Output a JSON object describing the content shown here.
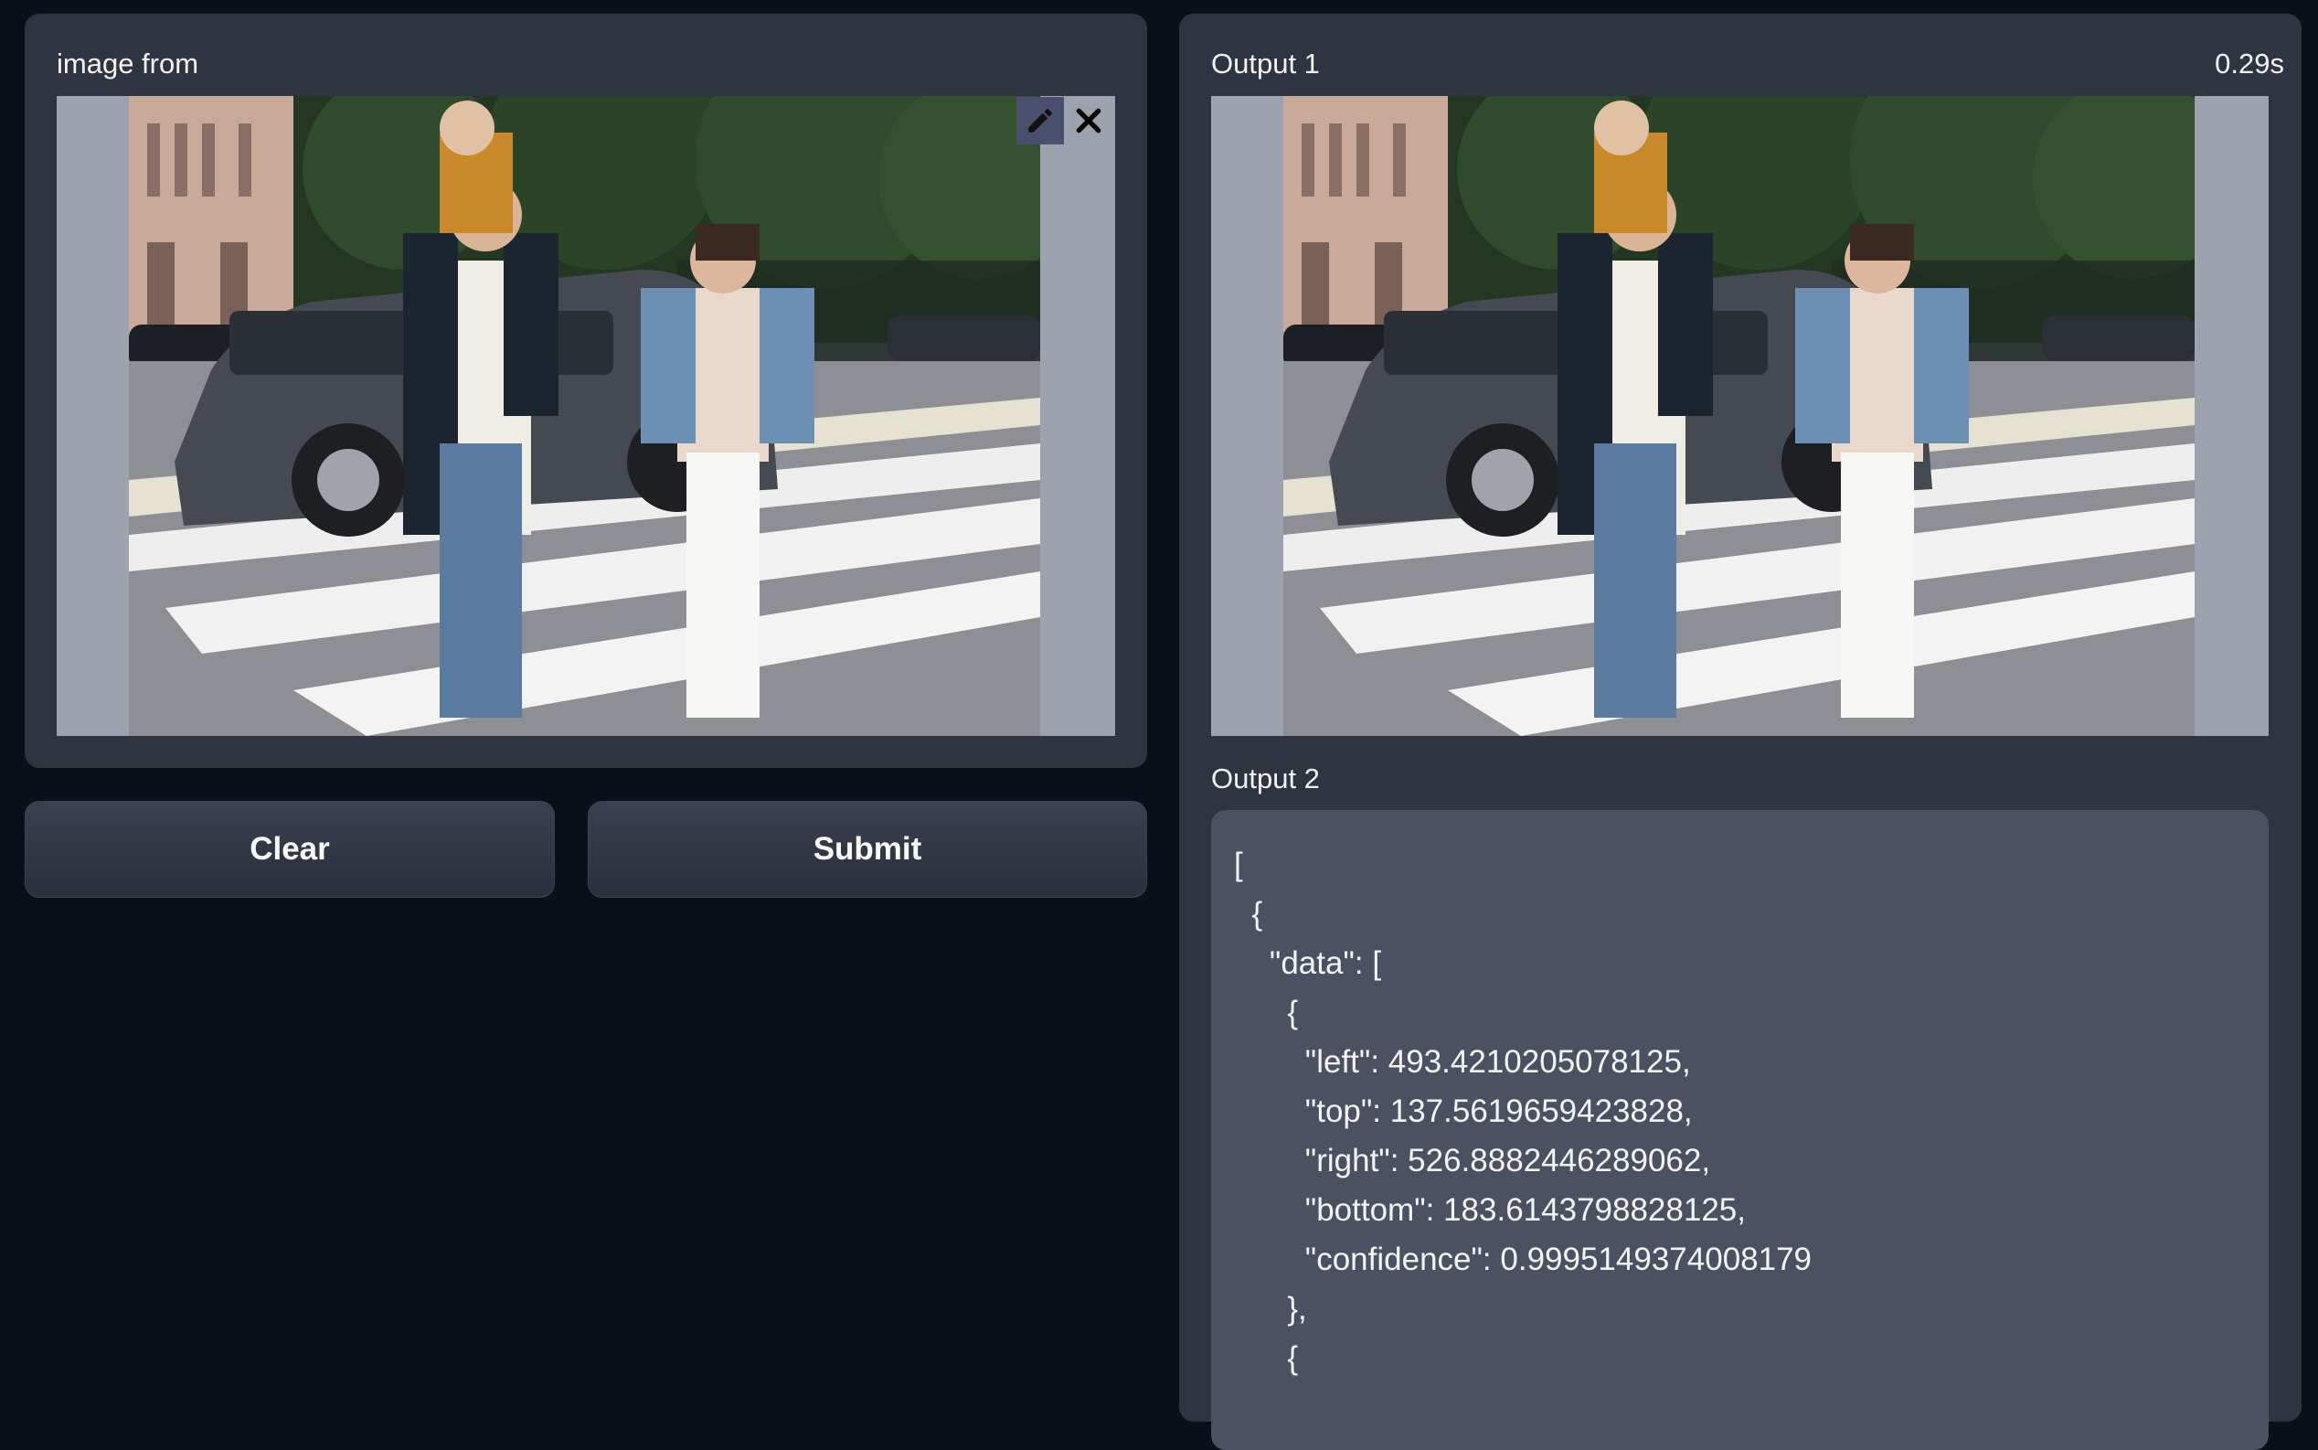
{
  "input": {
    "label": "image from",
    "edit_icon": "pencil-icon",
    "clear_icon": "close-icon"
  },
  "actions": {
    "clear_label": "Clear",
    "submit_label": "Submit"
  },
  "output1": {
    "label": "Output 1",
    "timing": "0.29s"
  },
  "output2": {
    "label": "Output 2",
    "json_lines": [
      "[",
      "  {",
      "    \"data\": [",
      "      {",
      "        \"left\": 493.4210205078125,",
      "        \"top\": 137.5619659423828,",
      "        \"right\": 526.8882446289062,",
      "        \"bottom\": 183.6143798828125,",
      "        \"confidence\": 0.9995149374008179",
      "      },",
      "      {"
    ]
  },
  "colors": {
    "background": "#0b0f19",
    "panel": "#2f3441",
    "json_box": "#4b5160",
    "image_letterbox": "#9ca3af"
  }
}
